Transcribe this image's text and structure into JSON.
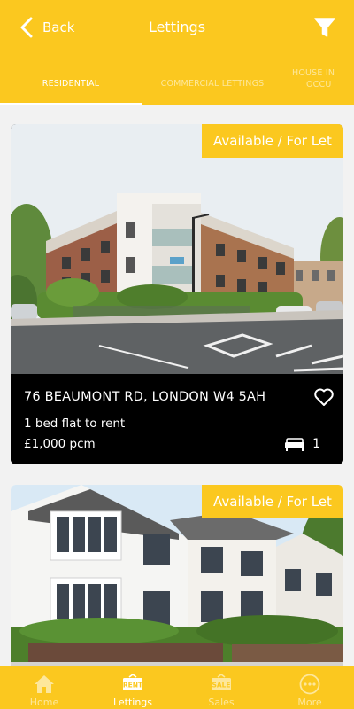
{
  "header": {
    "back_label": "Back",
    "title": "Lettings",
    "tabs": [
      {
        "label": "RESIDENTIAL",
        "active": true
      },
      {
        "label": "COMMERCIAL LETTINGS",
        "active": false
      },
      {
        "label": "HOUSE IN",
        "label_line2": "OCCU",
        "active": false
      }
    ]
  },
  "listings": [
    {
      "badge": "Available / For Let",
      "address": "76 BEAUMONT RD, LONDON W4 5AH",
      "description": "1 bed flat to rent",
      "price": "£1,000 pcm",
      "bedrooms": "1"
    },
    {
      "badge": "Available / For Let"
    }
  ],
  "bottom_nav": [
    {
      "label": "Home",
      "icon": "home-icon",
      "active": false
    },
    {
      "label": "Lettings",
      "icon": "rent-sign-icon",
      "icon_text": "RENT",
      "active": true
    },
    {
      "label": "Sales",
      "icon": "sale-sign-icon",
      "icon_text": "SALE",
      "active": false
    },
    {
      "label": "More",
      "icon": "more-icon",
      "active": false
    }
  ],
  "colors": {
    "brand_yellow": "#fbc81f",
    "inactive_tab": "#fde79b",
    "card_info_bg": "#000000"
  }
}
